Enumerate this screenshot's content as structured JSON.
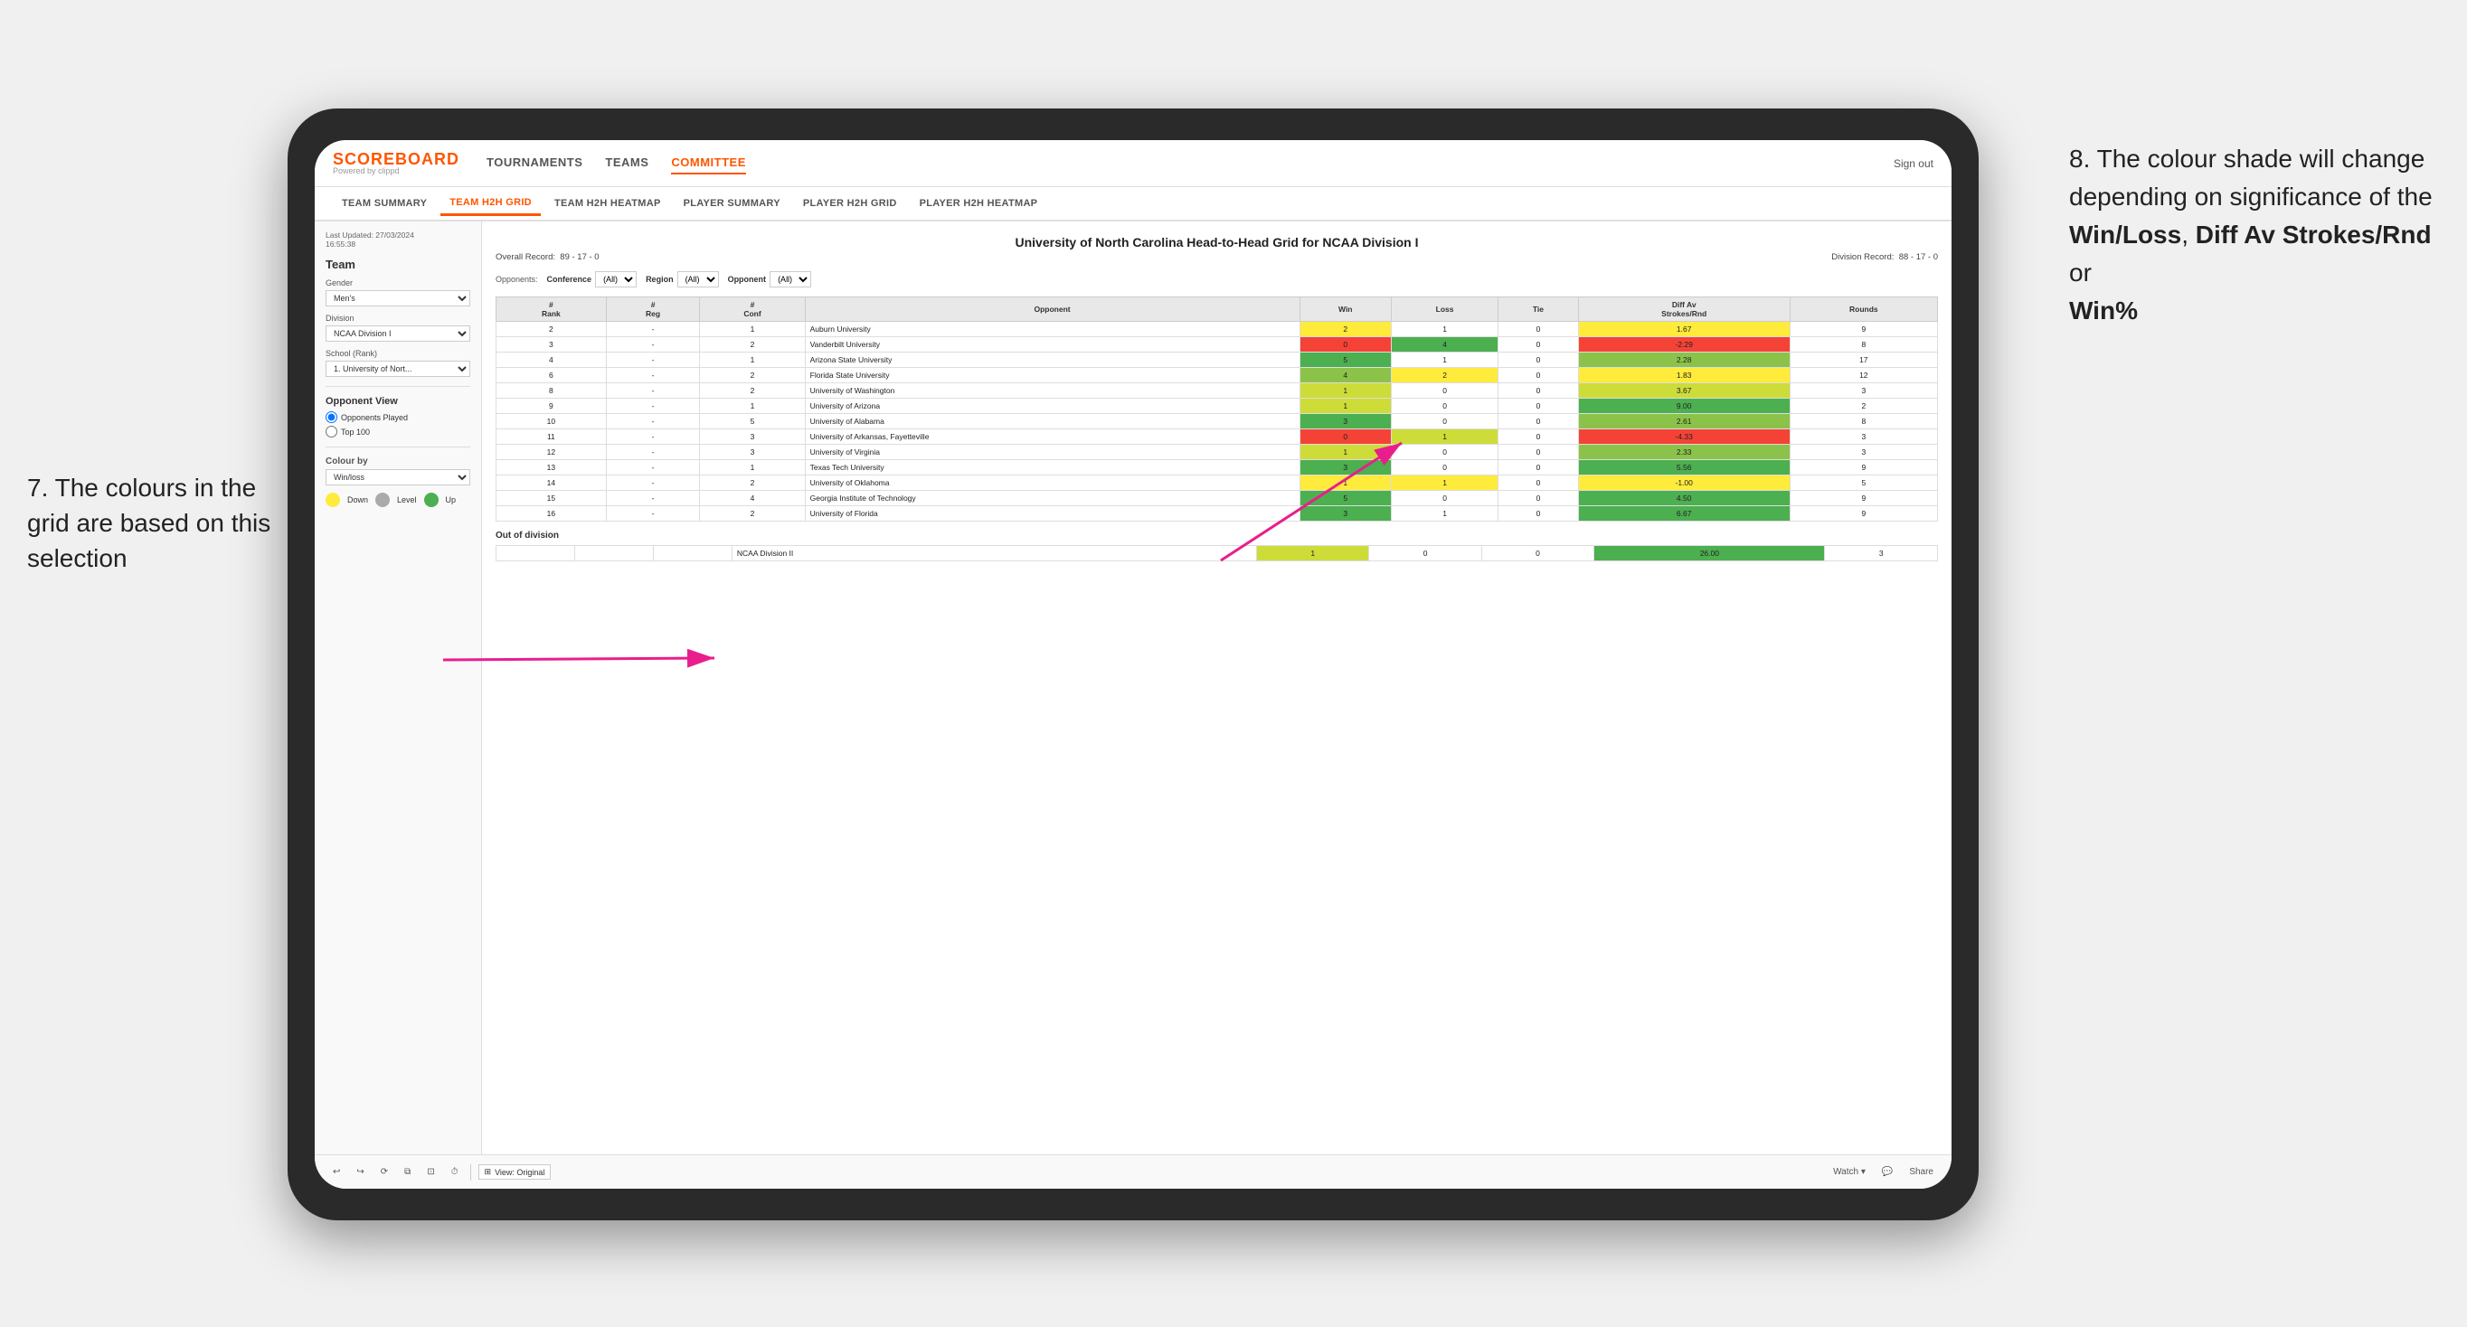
{
  "annotations": {
    "left_title": "7. The colours in the grid are based on this selection",
    "right_title": "8. The colour shade will change depending on significance of the",
    "right_bold1": "Win/Loss",
    "right_comma": ", ",
    "right_bold2": "Diff Av Strokes/Rnd",
    "right_or": " or",
    "right_bold3": "Win%"
  },
  "header": {
    "logo_title": "SCOREBOARD",
    "logo_subtitle": "Powered by clippd",
    "nav_items": [
      "TOURNAMENTS",
      "TEAMS",
      "COMMITTEE"
    ],
    "sign_out": "Sign out",
    "active_nav": "COMMITTEE"
  },
  "subnav": {
    "items": [
      "TEAM SUMMARY",
      "TEAM H2H GRID",
      "TEAM H2H HEATMAP",
      "PLAYER SUMMARY",
      "PLAYER H2H GRID",
      "PLAYER H2H HEATMAP"
    ],
    "active": "TEAM H2H GRID"
  },
  "sidebar": {
    "last_updated_label": "Last Updated: 27/03/2024",
    "last_updated_time": "16:55:38",
    "team_label": "Team",
    "gender_label": "Gender",
    "gender_value": "Men's",
    "division_label": "Division",
    "division_value": "NCAA Division I",
    "school_label": "School (Rank)",
    "school_value": "1. University of Nort...",
    "opponent_view_title": "Opponent View",
    "opponents_played": "Opponents Played",
    "top_100": "Top 100",
    "colour_by_label": "Colour by",
    "colour_by_value": "Win/loss",
    "legend_down": "Down",
    "legend_level": "Level",
    "legend_up": "Up"
  },
  "grid": {
    "title": "University of North Carolina Head-to-Head Grid for NCAA Division I",
    "overall_record_label": "Overall Record:",
    "overall_record": "89 - 17 - 0",
    "division_record_label": "Division Record:",
    "division_record": "88 - 17 - 0",
    "filters": {
      "opponents_label": "Opponents:",
      "conference_label": "Conference",
      "conference_value": "(All)",
      "region_label": "Region",
      "region_value": "(All)",
      "opponent_label": "Opponent",
      "opponent_value": "(All)"
    },
    "columns": [
      "#\nRank",
      "#\nReg",
      "#\nConf",
      "Opponent",
      "Win",
      "Loss",
      "Tie",
      "Diff Av\nStrokes/Rnd",
      "Rounds"
    ],
    "rows": [
      {
        "rank": "2",
        "reg": "-",
        "conf": "1",
        "opponent": "Auburn University",
        "win": 2,
        "loss": 1,
        "tie": 0,
        "diff": 1.67,
        "rounds": 9,
        "win_color": "yellow",
        "loss_color": "white",
        "diff_color": "yellow"
      },
      {
        "rank": "3",
        "reg": "-",
        "conf": "2",
        "opponent": "Vanderbilt University",
        "win": 0,
        "loss": 4,
        "tie": 0,
        "diff": -2.29,
        "rounds": 8,
        "win_color": "red",
        "loss_color": "green-dark",
        "diff_color": "red"
      },
      {
        "rank": "4",
        "reg": "-",
        "conf": "1",
        "opponent": "Arizona State University",
        "win": 5,
        "loss": 1,
        "tie": 0,
        "diff": 2.28,
        "rounds": 17,
        "win_color": "green-dark",
        "loss_color": "white",
        "diff_color": "green-med"
      },
      {
        "rank": "6",
        "reg": "-",
        "conf": "2",
        "opponent": "Florida State University",
        "win": 4,
        "loss": 2,
        "tie": 0,
        "diff": 1.83,
        "rounds": 12,
        "win_color": "green-med",
        "loss_color": "yellow",
        "diff_color": "yellow"
      },
      {
        "rank": "8",
        "reg": "-",
        "conf": "2",
        "opponent": "University of Washington",
        "win": 1,
        "loss": 0,
        "tie": 0,
        "diff": 3.67,
        "rounds": 3,
        "win_color": "green-light",
        "loss_color": "white",
        "diff_color": "green-light"
      },
      {
        "rank": "9",
        "reg": "-",
        "conf": "1",
        "opponent": "University of Arizona",
        "win": 1,
        "loss": 0,
        "tie": 0,
        "diff": 9.0,
        "rounds": 2,
        "win_color": "green-light",
        "loss_color": "white",
        "diff_color": "green-dark"
      },
      {
        "rank": "10",
        "reg": "-",
        "conf": "5",
        "opponent": "University of Alabama",
        "win": 3,
        "loss": 0,
        "tie": 0,
        "diff": 2.61,
        "rounds": 8,
        "win_color": "green-dark",
        "loss_color": "white",
        "diff_color": "green-med"
      },
      {
        "rank": "11",
        "reg": "-",
        "conf": "3",
        "opponent": "University of Arkansas, Fayetteville",
        "win": 0,
        "loss": 1,
        "tie": 0,
        "diff": -4.33,
        "rounds": 3,
        "win_color": "red",
        "loss_color": "green-light",
        "diff_color": "red"
      },
      {
        "rank": "12",
        "reg": "-",
        "conf": "3",
        "opponent": "University of Virginia",
        "win": 1,
        "loss": 0,
        "tie": 0,
        "diff": 2.33,
        "rounds": 3,
        "win_color": "green-light",
        "loss_color": "white",
        "diff_color": "green-med"
      },
      {
        "rank": "13",
        "reg": "-",
        "conf": "1",
        "opponent": "Texas Tech University",
        "win": 3,
        "loss": 0,
        "tie": 0,
        "diff": 5.56,
        "rounds": 9,
        "win_color": "green-dark",
        "loss_color": "white",
        "diff_color": "green-dark"
      },
      {
        "rank": "14",
        "reg": "-",
        "conf": "2",
        "opponent": "University of Oklahoma",
        "win": 1,
        "loss": 1,
        "tie": 0,
        "diff": -1.0,
        "rounds": 5,
        "win_color": "yellow",
        "loss_color": "yellow",
        "diff_color": "yellow"
      },
      {
        "rank": "15",
        "reg": "-",
        "conf": "4",
        "opponent": "Georgia Institute of Technology",
        "win": 5,
        "loss": 0,
        "tie": 0,
        "diff": 4.5,
        "rounds": 9,
        "win_color": "green-dark",
        "loss_color": "white",
        "diff_color": "green-dark"
      },
      {
        "rank": "16",
        "reg": "-",
        "conf": "2",
        "opponent": "University of Florida",
        "win": 3,
        "loss": 1,
        "tie": 0,
        "diff": 6.67,
        "rounds": 9,
        "win_color": "green-dark",
        "loss_color": "white",
        "diff_color": "green-dark"
      }
    ],
    "out_of_division_title": "Out of division",
    "out_of_division_rows": [
      {
        "opponent": "NCAA Division II",
        "win": 1,
        "loss": 0,
        "tie": 0,
        "diff": 26.0,
        "rounds": 3,
        "win_color": "green-light",
        "loss_color": "white",
        "diff_color": "green-dark"
      }
    ]
  },
  "toolbar": {
    "undo": "↩",
    "redo": "↪",
    "view_label": "View: Original",
    "watch_label": "Watch ▾",
    "share_label": "Share"
  }
}
